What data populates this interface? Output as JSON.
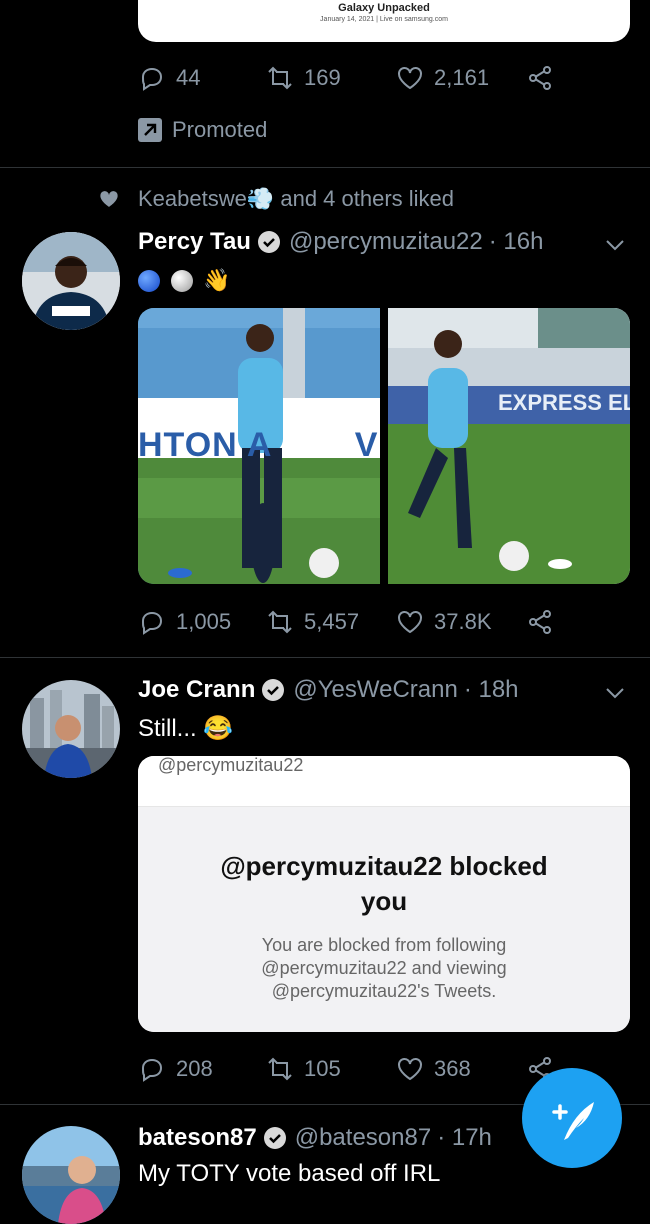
{
  "ad": {
    "card_title": "Galaxy Unpacked",
    "card_sub": "January 14, 2021 | Live on samsung.com",
    "replies": "44",
    "retweets": "169",
    "likes": "2,161",
    "promoted_label": "Promoted"
  },
  "tweet1": {
    "social_context": "Keabetswe💨 and 4 others liked",
    "name": "Percy Tau",
    "handle": "@percymuzitau22",
    "time": "· 16h",
    "text_emoji": "👋",
    "photo1_banner": "HTON A        VE ALB",
    "photo2_banner": "EXPRESS ELI",
    "replies": "1,005",
    "retweets": "5,457",
    "likes": "37.8K"
  },
  "tweet2": {
    "name": "Joe Crann",
    "handle": "@YesWeCrann",
    "time": "· 18h",
    "text": "Still... 😂",
    "card_handle": "@percymuzitau22",
    "card_title_line1": "@percymuzitau22 blocked",
    "card_title_line2": "you",
    "card_body_line1": "You are blocked from following",
    "card_body_line2": "@percymuzitau22 and viewing",
    "card_body_line3": "@percymuzitau22's Tweets.",
    "replies": "208",
    "retweets": "105",
    "likes": "368"
  },
  "tweet3": {
    "name": "bateson87",
    "handle": "@bateson87",
    "time": "· 17h",
    "text": "My TOTY vote based off IRL"
  },
  "colors": {
    "accent": "#1da1f2",
    "text_secondary": "#8b98a5",
    "background": "#000000"
  }
}
